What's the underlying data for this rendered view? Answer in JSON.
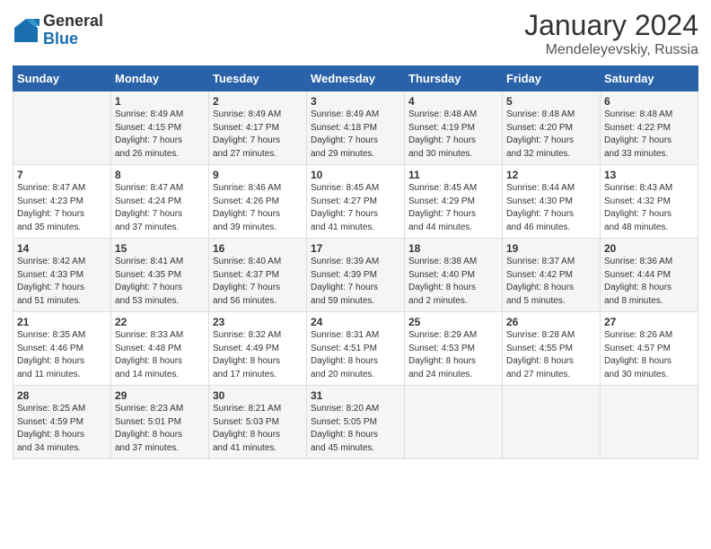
{
  "header": {
    "logo_general": "General",
    "logo_blue": "Blue",
    "month": "January 2024",
    "location": "Mendeleyevskiy, Russia"
  },
  "days_of_week": [
    "Sunday",
    "Monday",
    "Tuesday",
    "Wednesday",
    "Thursday",
    "Friday",
    "Saturday"
  ],
  "weeks": [
    [
      {
        "day": "",
        "info": ""
      },
      {
        "day": "1",
        "info": "Sunrise: 8:49 AM\nSunset: 4:15 PM\nDaylight: 7 hours\nand 26 minutes."
      },
      {
        "day": "2",
        "info": "Sunrise: 8:49 AM\nSunset: 4:17 PM\nDaylight: 7 hours\nand 27 minutes."
      },
      {
        "day": "3",
        "info": "Sunrise: 8:49 AM\nSunset: 4:18 PM\nDaylight: 7 hours\nand 29 minutes."
      },
      {
        "day": "4",
        "info": "Sunrise: 8:48 AM\nSunset: 4:19 PM\nDaylight: 7 hours\nand 30 minutes."
      },
      {
        "day": "5",
        "info": "Sunrise: 8:48 AM\nSunset: 4:20 PM\nDaylight: 7 hours\nand 32 minutes."
      },
      {
        "day": "6",
        "info": "Sunrise: 8:48 AM\nSunset: 4:22 PM\nDaylight: 7 hours\nand 33 minutes."
      }
    ],
    [
      {
        "day": "7",
        "info": "Sunrise: 8:47 AM\nSunset: 4:23 PM\nDaylight: 7 hours\nand 35 minutes."
      },
      {
        "day": "8",
        "info": "Sunrise: 8:47 AM\nSunset: 4:24 PM\nDaylight: 7 hours\nand 37 minutes."
      },
      {
        "day": "9",
        "info": "Sunrise: 8:46 AM\nSunset: 4:26 PM\nDaylight: 7 hours\nand 39 minutes."
      },
      {
        "day": "10",
        "info": "Sunrise: 8:45 AM\nSunset: 4:27 PM\nDaylight: 7 hours\nand 41 minutes."
      },
      {
        "day": "11",
        "info": "Sunrise: 8:45 AM\nSunset: 4:29 PM\nDaylight: 7 hours\nand 44 minutes."
      },
      {
        "day": "12",
        "info": "Sunrise: 8:44 AM\nSunset: 4:30 PM\nDaylight: 7 hours\nand 46 minutes."
      },
      {
        "day": "13",
        "info": "Sunrise: 8:43 AM\nSunset: 4:32 PM\nDaylight: 7 hours\nand 48 minutes."
      }
    ],
    [
      {
        "day": "14",
        "info": "Sunrise: 8:42 AM\nSunset: 4:33 PM\nDaylight: 7 hours\nand 51 minutes."
      },
      {
        "day": "15",
        "info": "Sunrise: 8:41 AM\nSunset: 4:35 PM\nDaylight: 7 hours\nand 53 minutes."
      },
      {
        "day": "16",
        "info": "Sunrise: 8:40 AM\nSunset: 4:37 PM\nDaylight: 7 hours\nand 56 minutes."
      },
      {
        "day": "17",
        "info": "Sunrise: 8:39 AM\nSunset: 4:39 PM\nDaylight: 7 hours\nand 59 minutes."
      },
      {
        "day": "18",
        "info": "Sunrise: 8:38 AM\nSunset: 4:40 PM\nDaylight: 8 hours\nand 2 minutes."
      },
      {
        "day": "19",
        "info": "Sunrise: 8:37 AM\nSunset: 4:42 PM\nDaylight: 8 hours\nand 5 minutes."
      },
      {
        "day": "20",
        "info": "Sunrise: 8:36 AM\nSunset: 4:44 PM\nDaylight: 8 hours\nand 8 minutes."
      }
    ],
    [
      {
        "day": "21",
        "info": "Sunrise: 8:35 AM\nSunset: 4:46 PM\nDaylight: 8 hours\nand 11 minutes."
      },
      {
        "day": "22",
        "info": "Sunrise: 8:33 AM\nSunset: 4:48 PM\nDaylight: 8 hours\nand 14 minutes."
      },
      {
        "day": "23",
        "info": "Sunrise: 8:32 AM\nSunset: 4:49 PM\nDaylight: 8 hours\nand 17 minutes."
      },
      {
        "day": "24",
        "info": "Sunrise: 8:31 AM\nSunset: 4:51 PM\nDaylight: 8 hours\nand 20 minutes."
      },
      {
        "day": "25",
        "info": "Sunrise: 8:29 AM\nSunset: 4:53 PM\nDaylight: 8 hours\nand 24 minutes."
      },
      {
        "day": "26",
        "info": "Sunrise: 8:28 AM\nSunset: 4:55 PM\nDaylight: 8 hours\nand 27 minutes."
      },
      {
        "day": "27",
        "info": "Sunrise: 8:26 AM\nSunset: 4:57 PM\nDaylight: 8 hours\nand 30 minutes."
      }
    ],
    [
      {
        "day": "28",
        "info": "Sunrise: 8:25 AM\nSunset: 4:59 PM\nDaylight: 8 hours\nand 34 minutes."
      },
      {
        "day": "29",
        "info": "Sunrise: 8:23 AM\nSunset: 5:01 PM\nDaylight: 8 hours\nand 37 minutes."
      },
      {
        "day": "30",
        "info": "Sunrise: 8:21 AM\nSunset: 5:03 PM\nDaylight: 8 hours\nand 41 minutes."
      },
      {
        "day": "31",
        "info": "Sunrise: 8:20 AM\nSunset: 5:05 PM\nDaylight: 8 hours\nand 45 minutes."
      },
      {
        "day": "",
        "info": ""
      },
      {
        "day": "",
        "info": ""
      },
      {
        "day": "",
        "info": ""
      }
    ]
  ]
}
